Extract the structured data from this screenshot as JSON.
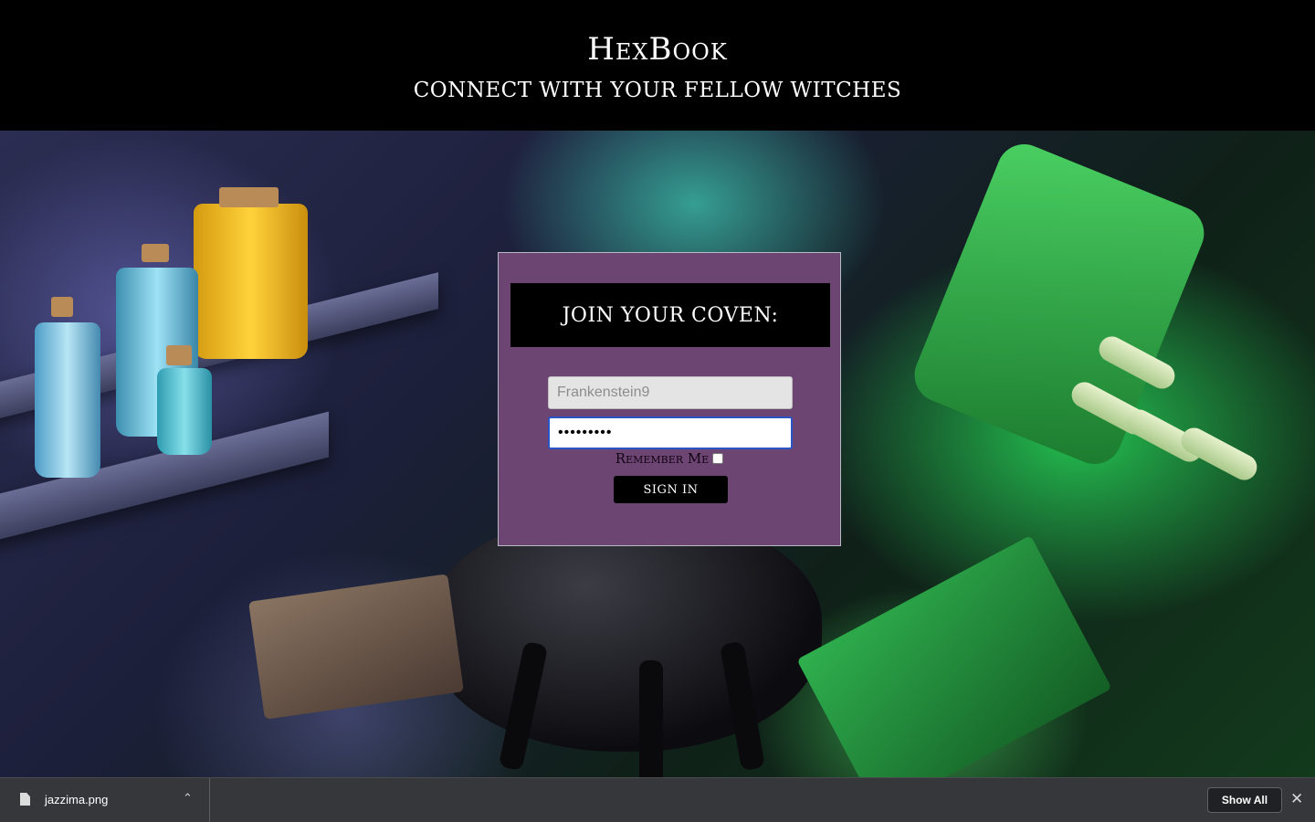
{
  "header": {
    "brand": "HexBook",
    "tagline": "CONNECT WITH YOUR FELLOW WITCHES"
  },
  "login": {
    "title": "JOIN YOUR COVEN:",
    "username_value": "Frankenstein9",
    "password_value": "•••••••••",
    "remember_label": "Remember Me",
    "remember_checked": false,
    "signin_label": "SIGN IN"
  },
  "download_bar": {
    "file_name": "jazzima.png",
    "file_icon": "file-icon",
    "chevron_icon": "chevron-up-icon",
    "show_all_label": "Show All",
    "close_icon": "close-icon"
  },
  "colors": {
    "panel": "#6c4572",
    "header": "#000000",
    "focus": "#2a55c7",
    "download_bar": "#36373a"
  }
}
